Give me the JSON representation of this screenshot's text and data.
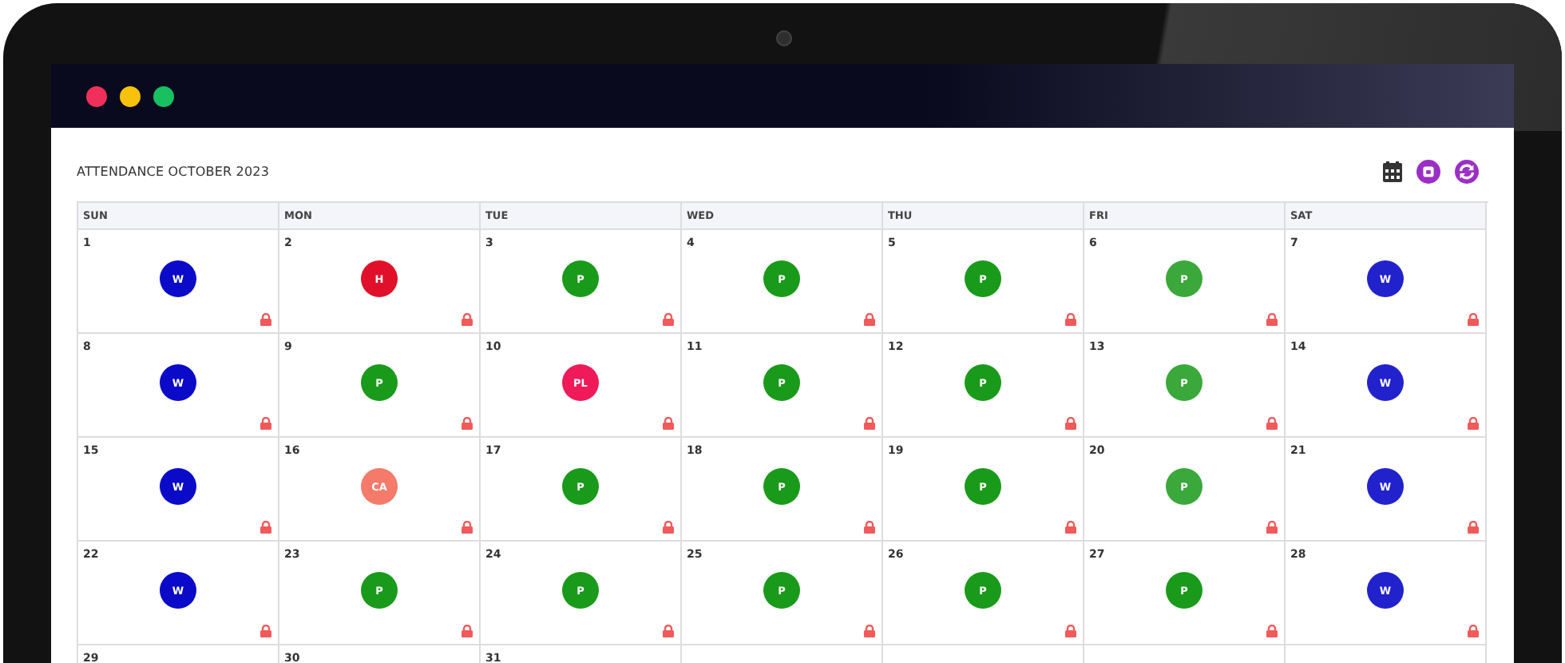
{
  "title": "ATTENDANCE OCTOBER 2023",
  "weekdays": [
    "SUN",
    "MON",
    "TUE",
    "WED",
    "THU",
    "FRI",
    "SAT"
  ],
  "weeks": [
    [
      {
        "day": "1",
        "status": "W",
        "color": "#0a0ac8",
        "locked": true
      },
      {
        "day": "2",
        "status": "H",
        "color": "#e0102a",
        "locked": true
      },
      {
        "day": "3",
        "status": "P",
        "color": "#1a9a1a",
        "locked": true
      },
      {
        "day": "4",
        "status": "P",
        "color": "#1a9a1a",
        "locked": true
      },
      {
        "day": "5",
        "status": "P",
        "color": "#1a9a1a",
        "locked": true
      },
      {
        "day": "6",
        "status": "P",
        "color": "#3aa83a",
        "locked": true
      },
      {
        "day": "7",
        "status": "W",
        "color": "#2222cc",
        "locked": true
      }
    ],
    [
      {
        "day": "8",
        "status": "W",
        "color": "#0a0ac8",
        "locked": true
      },
      {
        "day": "9",
        "status": "P",
        "color": "#1a9a1a",
        "locked": true
      },
      {
        "day": "10",
        "status": "PL",
        "color": "#ee1a5a",
        "locked": true
      },
      {
        "day": "11",
        "status": "P",
        "color": "#1a9a1a",
        "locked": true
      },
      {
        "day": "12",
        "status": "P",
        "color": "#1a9a1a",
        "locked": true
      },
      {
        "day": "13",
        "status": "P",
        "color": "#3aa83a",
        "locked": true
      },
      {
        "day": "14",
        "status": "W",
        "color": "#2222cc",
        "locked": true
      }
    ],
    [
      {
        "day": "15",
        "status": "W",
        "color": "#0a0ac8",
        "locked": true
      },
      {
        "day": "16",
        "status": "CA",
        "color": "#f47a6a",
        "locked": true
      },
      {
        "day": "17",
        "status": "P",
        "color": "#1a9a1a",
        "locked": true
      },
      {
        "day": "18",
        "status": "P",
        "color": "#1a9a1a",
        "locked": true
      },
      {
        "day": "19",
        "status": "P",
        "color": "#1a9a1a",
        "locked": true
      },
      {
        "day": "20",
        "status": "P",
        "color": "#3aa83a",
        "locked": true
      },
      {
        "day": "21",
        "status": "W",
        "color": "#2222cc",
        "locked": true
      }
    ],
    [
      {
        "day": "22",
        "status": "W",
        "color": "#0a0ac8",
        "locked": true
      },
      {
        "day": "23",
        "status": "P",
        "color": "#1a9a1a",
        "locked": true
      },
      {
        "day": "24",
        "status": "P",
        "color": "#1a9a1a",
        "locked": true
      },
      {
        "day": "25",
        "status": "P",
        "color": "#1a9a1a",
        "locked": true
      },
      {
        "day": "26",
        "status": "P",
        "color": "#1a9a1a",
        "locked": true
      },
      {
        "day": "27",
        "status": "P",
        "color": "#1a9a1a",
        "locked": true
      },
      {
        "day": "28",
        "status": "W",
        "color": "#2222cc",
        "locked": true
      }
    ],
    [
      {
        "day": "29"
      },
      {
        "day": "30"
      },
      {
        "day": "31"
      }
    ]
  ]
}
